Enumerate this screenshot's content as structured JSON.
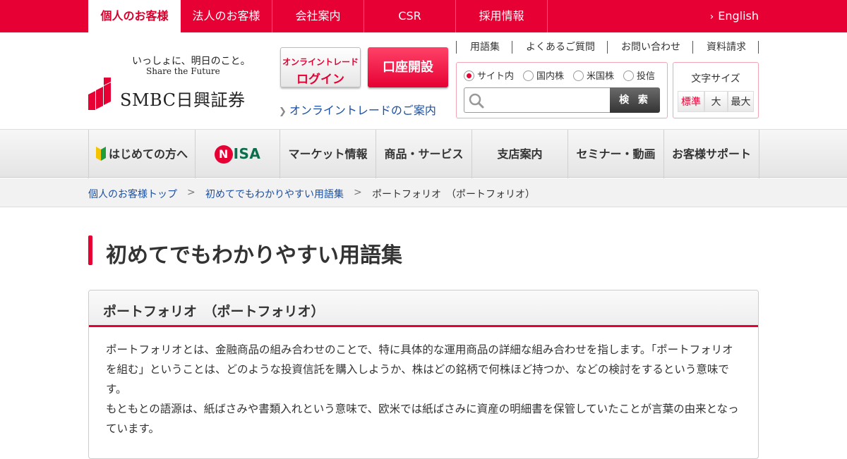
{
  "top_nav": {
    "tabs": [
      "個人のお客様",
      "法人のお客様",
      "会社案内",
      "CSR",
      "採用情報"
    ],
    "english": "English"
  },
  "logo": {
    "tagline_ja": "いっしょに、明日のこと。",
    "tagline_en": "Share the Future",
    "name": "SMBC日興証券"
  },
  "header": {
    "login_line1": "オンライントレード",
    "login_line2": "ログイン",
    "open_account": "口座開設",
    "online_trade_link": "オンライントレードのご案内"
  },
  "utility_links": [
    "用語集",
    "よくあるご質問",
    "お問い合わせ",
    "資料請求"
  ],
  "search": {
    "options": [
      "サイト内",
      "国内株",
      "米国株",
      "投信"
    ],
    "selected": "サイト内",
    "button": "検 索",
    "placeholder": ""
  },
  "font_size": {
    "label": "文字サイズ",
    "options": [
      "標準",
      "大",
      "最大"
    ],
    "selected": "標準"
  },
  "main_nav": {
    "beginner": "はじめての方へ",
    "nisa_n": "N",
    "nisa_rest": "ISA",
    "items": [
      "マーケット情報",
      "商品・サービス",
      "支店案内",
      "セミナー・動画",
      "お客様サポート"
    ]
  },
  "breadcrumb": {
    "items": [
      "個人のお客様トップ",
      "初めてでもわかりやすい用語集"
    ],
    "separator": ">",
    "current": "ポートフォリオ　（ポートフォリオ）"
  },
  "page": {
    "title": "初めてでもわかりやすい用語集",
    "term": "ポートフォリオ　（ポートフォリオ）",
    "definition_p1": "ポートフォリオとは、金融商品の組み合わせのことで、特に具体的な運用商品の詳細な組み合わせを指します。「ポートフォリオを組む」ということは、どのような投資信託を購入しようか、株はどの銘柄で何株ほど持つか、などの検討をするという意味です。",
    "definition_p2": "もともとの語源は、紙ばさみや書類入れという意味で、欧米では紙ばさみに資産の明細書を保管していたことが言葉の由来となっています。"
  },
  "colors": {
    "brand_red": "#e60033",
    "link_blue": "#1a4fa3",
    "nisa_green": "#0b6e4f"
  }
}
